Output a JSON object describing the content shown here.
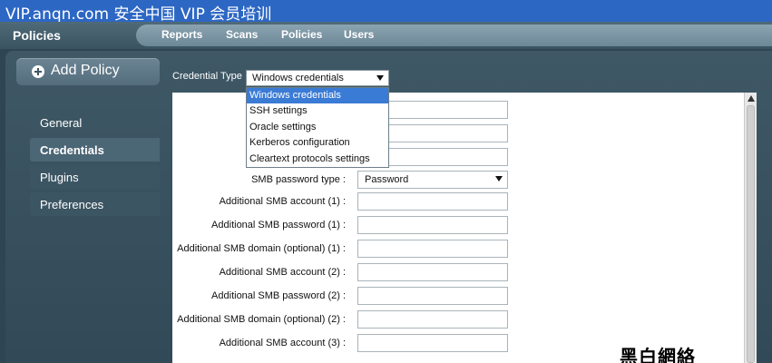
{
  "banner": {
    "text": "VIP.anqn.com  安全中国 VIP 会员培训"
  },
  "header": {
    "brand": "Policies",
    "nav": [
      "Reports",
      "Scans",
      "Policies",
      "Users"
    ]
  },
  "add_policy": {
    "label": "Add Policy",
    "icon": "plus-circle-icon"
  },
  "sidebar": {
    "items": [
      {
        "label": "General",
        "active": false
      },
      {
        "label": "Credentials",
        "active": true
      },
      {
        "label": "Plugins",
        "active": false
      },
      {
        "label": "Preferences",
        "active": false
      }
    ]
  },
  "credential_type": {
    "label": "Credential Type",
    "selected": "Windows credentials",
    "options": [
      "Windows credentials",
      "SSH settings",
      "Oracle settings",
      "Kerberos configuration",
      "Cleartext protocols settings"
    ]
  },
  "form": {
    "smb_password_type": {
      "label": "SMB password type :",
      "value": "Password"
    },
    "fields": [
      "Additional SMB account (1) :",
      "Additional SMB password (1) :",
      "Additional SMB domain (optional) (1) :",
      "Additional SMB account (2) :",
      "Additional SMB password (2) :",
      "Additional SMB domain (optional) (2) :",
      "Additional SMB account (3) :"
    ]
  },
  "watermark": {
    "text": "黑白網絡"
  },
  "colors": {
    "banner": "#2d67c4",
    "panel": "#3f5866",
    "selection": "#3a7bd5"
  }
}
